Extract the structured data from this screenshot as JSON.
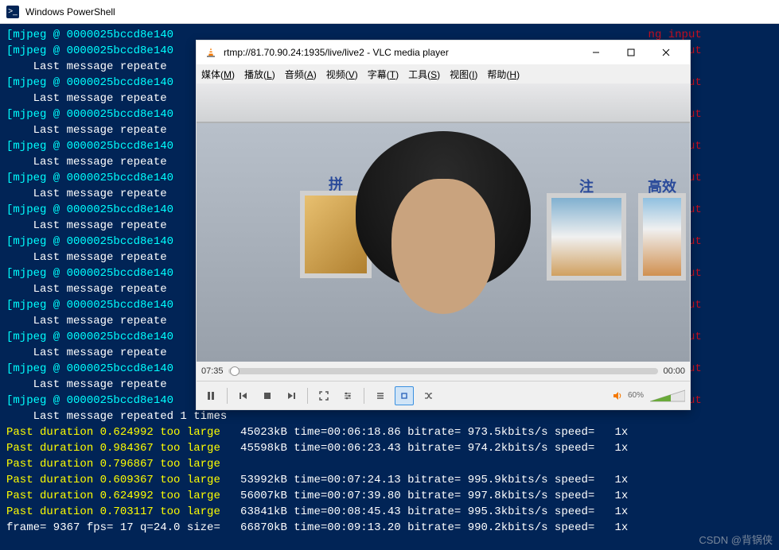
{
  "ps": {
    "title": "Windows PowerShell",
    "lines": [
      {
        "segs": [
          {
            "c": "cyan",
            "t": "[mjpeg @ 0000025bccd8e140"
          },
          {
            "c": "darkred",
            "t": "                                                                       ng input"
          }
        ]
      },
      {
        "segs": [
          {
            "c": "cyan",
            "t": "[mjpeg @ 0000025bccd8e140"
          },
          {
            "c": "darkred",
            "t": "                                                                       ng input"
          }
        ]
      },
      {
        "segs": [
          {
            "c": "white",
            "t": "    Last message repeate"
          }
        ]
      },
      {
        "segs": [
          {
            "c": "cyan",
            "t": "[mjpeg @ 0000025bccd8e140"
          },
          {
            "c": "darkred",
            "t": "                                                                       ng input"
          }
        ]
      },
      {
        "segs": [
          {
            "c": "white",
            "t": "    Last message repeate"
          }
        ]
      },
      {
        "segs": [
          {
            "c": "cyan",
            "t": "[mjpeg @ 0000025bccd8e140"
          },
          {
            "c": "darkred",
            "t": "                                                                       ng input"
          }
        ]
      },
      {
        "segs": [
          {
            "c": "white",
            "t": "    Last message repeate"
          }
        ]
      },
      {
        "segs": [
          {
            "c": "cyan",
            "t": "[mjpeg @ 0000025bccd8e140"
          },
          {
            "c": "darkred",
            "t": "                                                                       ng input"
          }
        ]
      },
      {
        "segs": [
          {
            "c": "white",
            "t": "    Last message repeate"
          }
        ]
      },
      {
        "segs": [
          {
            "c": "cyan",
            "t": "[mjpeg @ 0000025bccd8e140"
          },
          {
            "c": "darkred",
            "t": "                                                                       ng input"
          }
        ]
      },
      {
        "segs": [
          {
            "c": "white",
            "t": "    Last message repeate"
          }
        ]
      },
      {
        "segs": [
          {
            "c": "cyan",
            "t": "[mjpeg @ 0000025bccd8e140"
          },
          {
            "c": "darkred",
            "t": "                                                                       ng input"
          }
        ]
      },
      {
        "segs": [
          {
            "c": "white",
            "t": "    Last message repeate"
          }
        ]
      },
      {
        "segs": [
          {
            "c": "cyan",
            "t": "[mjpeg @ 0000025bccd8e140"
          },
          {
            "c": "darkred",
            "t": "                                                                       ng input"
          }
        ]
      },
      {
        "segs": [
          {
            "c": "white",
            "t": "    Last message repeate"
          }
        ]
      },
      {
        "segs": [
          {
            "c": "cyan",
            "t": "[mjpeg @ 0000025bccd8e140"
          },
          {
            "c": "darkred",
            "t": "                                                                       ng input"
          }
        ]
      },
      {
        "segs": [
          {
            "c": "white",
            "t": "    Last message repeate"
          }
        ]
      },
      {
        "segs": [
          {
            "c": "cyan",
            "t": "[mjpeg @ 0000025bccd8e140"
          },
          {
            "c": "darkred",
            "t": "                                                                       ng input"
          }
        ]
      },
      {
        "segs": [
          {
            "c": "white",
            "t": "    Last message repeate"
          }
        ]
      },
      {
        "segs": [
          {
            "c": "cyan",
            "t": "[mjpeg @ 0000025bccd8e140"
          },
          {
            "c": "darkred",
            "t": "                                                                       ng input"
          }
        ]
      },
      {
        "segs": [
          {
            "c": "white",
            "t": "    Last message repeate"
          }
        ]
      },
      {
        "segs": [
          {
            "c": "cyan",
            "t": "[mjpeg @ 0000025bccd8e140"
          },
          {
            "c": "darkred",
            "t": "                                                                       ng input"
          }
        ]
      },
      {
        "segs": [
          {
            "c": "white",
            "t": "    Last message repeate"
          }
        ]
      },
      {
        "segs": [
          {
            "c": "cyan",
            "t": "[mjpeg @ 0000025bccd8e140"
          },
          {
            "c": "darkred",
            "t": "                                                                       ng input"
          }
        ]
      },
      {
        "segs": [
          {
            "c": "white",
            "t": "    Last message repeated 1 times"
          }
        ]
      },
      {
        "segs": [
          {
            "c": "yellow",
            "t": "Past duration 0.624992 too large"
          },
          {
            "c": "white",
            "t": "   45023kB time=00:06:18.86 bitrate= 973.5kbits/s speed=   1x"
          }
        ]
      },
      {
        "segs": [
          {
            "c": "yellow",
            "t": "Past duration 0.984367 too large"
          },
          {
            "c": "white",
            "t": "   45598kB time=00:06:23.43 bitrate= 974.2kbits/s speed=   1x"
          }
        ]
      },
      {
        "segs": [
          {
            "c": "yellow",
            "t": "Past duration 0.796867 too large"
          }
        ]
      },
      {
        "segs": [
          {
            "c": "yellow",
            "t": "Past duration 0.609367 too large"
          },
          {
            "c": "white",
            "t": "   53992kB time=00:07:24.13 bitrate= 995.9kbits/s speed=   1x"
          }
        ]
      },
      {
        "segs": [
          {
            "c": "yellow",
            "t": "Past duration 0.624992 too large"
          },
          {
            "c": "white",
            "t": "   56007kB time=00:07:39.80 bitrate= 997.8kbits/s speed=   1x"
          }
        ]
      },
      {
        "segs": [
          {
            "c": "yellow",
            "t": "Past duration 0.703117 too large"
          },
          {
            "c": "white",
            "t": "   63841kB time=00:08:45.43 bitrate= 995.3kbits/s speed=   1x"
          }
        ]
      },
      {
        "segs": [
          {
            "c": "white",
            "t": "frame= 9367 fps= 17 q=24.0 size=   66870kB time=00:09:13.20 bitrate= 990.2kbits/s speed=   1x"
          }
        ]
      }
    ]
  },
  "vlc": {
    "title": "rtmp://81.70.90.24:1935/live/live2 - VLC media player",
    "menu": [
      "媒体(M)",
      "播放(L)",
      "音频(A)",
      "视频(V)",
      "字幕(T)",
      "工具(S)",
      "视图(I)",
      "帮助(H)"
    ],
    "posters": {
      "p1": "拼",
      "p2": "注",
      "p3": "高效"
    },
    "seek": {
      "elapsed": "07:35",
      "remaining": "00:00"
    },
    "volume": "60%"
  },
  "watermark": "CSDN @背锅侠"
}
